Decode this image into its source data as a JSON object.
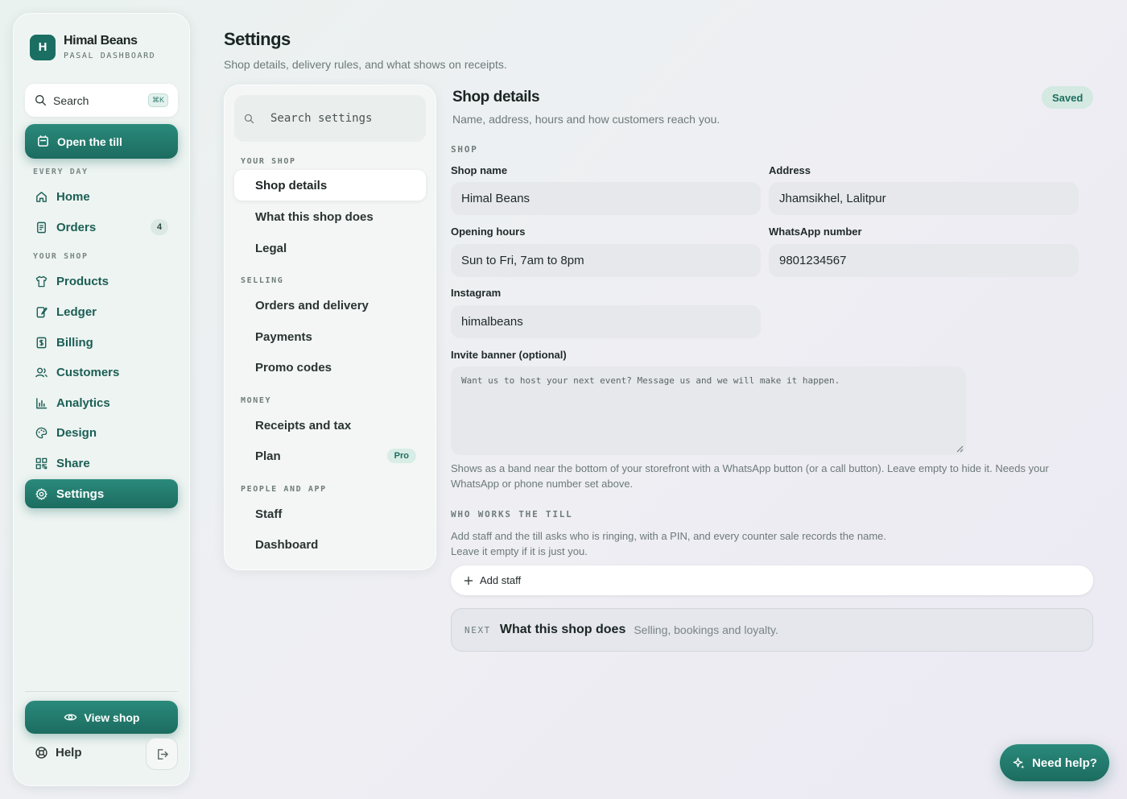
{
  "brand": {
    "logo_letter": "H",
    "name": "Himal Beans",
    "subtitle": "PASAL DASHBOARD"
  },
  "sidebar": {
    "search_label": "Search",
    "search_shortcut": "⌘K",
    "open_till": "Open the till",
    "sections": {
      "every_day": "EVERY DAY",
      "your_shop": "YOUR SHOP"
    },
    "items": [
      {
        "label": "Home",
        "icon": "home-icon"
      },
      {
        "label": "Orders",
        "icon": "orders-icon",
        "badge": "4"
      },
      {
        "label": "Products",
        "icon": "shirt-icon"
      },
      {
        "label": "Ledger",
        "icon": "ledger-icon"
      },
      {
        "label": "Billing",
        "icon": "billing-icon"
      },
      {
        "label": "Customers",
        "icon": "users-icon"
      },
      {
        "label": "Analytics",
        "icon": "chart-icon"
      },
      {
        "label": "Design",
        "icon": "palette-icon"
      },
      {
        "label": "Share",
        "icon": "qr-icon"
      },
      {
        "label": "Settings",
        "icon": "gear-icon",
        "active": true
      }
    ],
    "view_shop": "View shop",
    "help": "Help"
  },
  "header": {
    "title": "Settings",
    "subtitle": "Shop details, delivery rules, and what shows on receipts."
  },
  "settings_nav": {
    "search_placeholder": "Search settings",
    "sections": [
      {
        "label": "YOUR SHOP",
        "items": [
          "Shop details",
          "What this shop does",
          "Legal"
        ]
      },
      {
        "label": "SELLING",
        "items": [
          "Orders and delivery",
          "Payments",
          "Promo codes"
        ]
      },
      {
        "label": "MONEY",
        "items": [
          "Receipts and tax",
          "Plan"
        ]
      },
      {
        "label": "PEOPLE AND APP",
        "items": [
          "Staff",
          "Dashboard"
        ]
      }
    ],
    "active": "Shop details",
    "plan_badge": "Pro"
  },
  "main": {
    "title": "Shop details",
    "subtitle": "Name, address, hours and how customers reach you.",
    "status": "Saved",
    "shop_section": "SHOP",
    "fields": {
      "shop_name": {
        "label": "Shop name",
        "value": "Himal Beans"
      },
      "address": {
        "label": "Address",
        "value": "Jhamsikhel, Lalitpur"
      },
      "opening_hours": {
        "label": "Opening hours",
        "value": "Sun to Fri, 7am to 8pm"
      },
      "whatsapp": {
        "label": "WhatsApp number",
        "value": "9801234567"
      },
      "instagram": {
        "label": "Instagram",
        "value": "himalbeans"
      },
      "invite_banner": {
        "label": "Invite banner (optional)",
        "placeholder": "Want us to host your next event? Message us and we will make it happen.",
        "help_line1": "Shows as a band near the bottom of your storefront with a WhatsApp button (or a call button). Leave empty to hide it. Needs your",
        "help_line2": "WhatsApp or phone number set above."
      }
    },
    "staff_section": "WHO WORKS THE TILL",
    "staff_help_line1": "Add staff and the till asks who is ringing, with a PIN, and every counter sale records the name.",
    "staff_help_line2": "Leave it empty if it is just you.",
    "add_staff": "Add staff",
    "next": {
      "tag": "NEXT",
      "title": "What this shop does",
      "subtitle": "Selling, bookings and loyalty."
    }
  },
  "need_help": "Need help?",
  "colors": {
    "accent": "#1f7568",
    "accent_light": "#d3e9e2"
  }
}
